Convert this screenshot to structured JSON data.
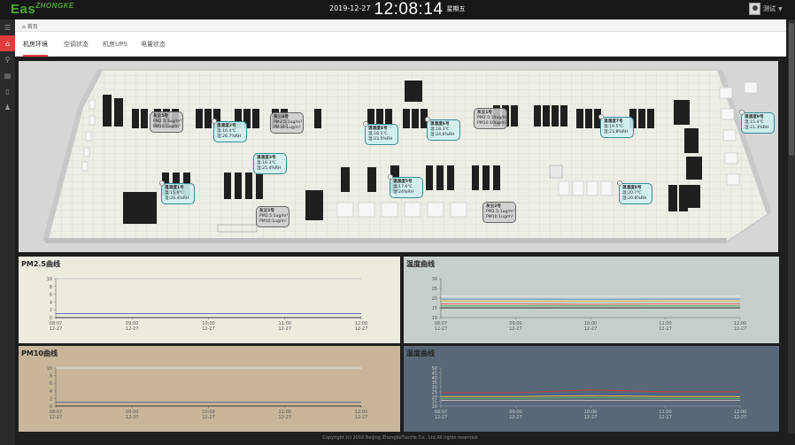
{
  "header": {
    "logo_main": "Eas",
    "logo_sup": "ZHONGKE",
    "date": "2019-12-27",
    "time": "12:08:14",
    "weekday": "星期五",
    "username": "测试"
  },
  "sidebar": {
    "icons": [
      "menu-icon",
      "home-icon",
      "search-icon",
      "list-icon",
      "bookmark-icon",
      "user-icon"
    ],
    "active": 1
  },
  "breadcrumb": {
    "label": "首页"
  },
  "tabs": [
    {
      "label": "机房环境",
      "active": true
    },
    {
      "label": "空调状态",
      "active": false
    },
    {
      "label": "机房UPS",
      "active": false
    },
    {
      "label": "电量状态",
      "active": false
    }
  ],
  "sensors": [
    {
      "kind": "dust",
      "title": "灰尘5号",
      "l1": "PM2.5:1ug/m³",
      "l2": "PM10:1ug/m³"
    },
    {
      "kind": "th",
      "title": "温湿度2号",
      "l1": "温:16.4℃",
      "l2": "湿:26.7%RH"
    },
    {
      "kind": "dust",
      "title": "灰尘4号",
      "l1": "PM2.5:1ug/m³",
      "l2": "PM10:1ug/m³"
    },
    {
      "kind": "th",
      "title": "温湿度4号",
      "l1": "温:18.2℃",
      "l2": "湿:23.5%RH"
    },
    {
      "kind": "th",
      "title": "温湿度6号",
      "l1": "温:18.3℃",
      "l2": "湿:24.6%RH"
    },
    {
      "kind": "dust",
      "title": "灰尘1号",
      "l1": "PM2.5:10ug/m³",
      "l2": "PM10:10ug/m³"
    },
    {
      "kind": "th",
      "title": "温湿度7号",
      "l1": "温:19.5℃",
      "l2": "湿:23.8%RH"
    },
    {
      "kind": "th",
      "title": "温湿度9号",
      "l1": "温:15.4℃",
      "l2": "湿:21.3%RH"
    },
    {
      "kind": "th",
      "title": "温湿度3号",
      "l1": "温:16.3℃",
      "l2": "湿:25.4%RH"
    },
    {
      "kind": "th",
      "title": "温湿度1号",
      "l1": "温:15.9℃",
      "l2": "湿:28.4%RH"
    },
    {
      "kind": "th",
      "title": "温湿度5号",
      "l1": "温:17.6℃",
      "l2": "湿:24%RH"
    },
    {
      "kind": "dust",
      "title": "灰尘1号",
      "l1": "PM2.5:1ug/m³",
      "l2": "PM10:1ug/m³"
    },
    {
      "kind": "dust",
      "title": "灰尘2号",
      "l1": "PM2.5:1ug/m³",
      "l2": "PM10:1ug/m³"
    },
    {
      "kind": "th",
      "title": "温湿度8号",
      "l1": "温:20.7℃",
      "l2": "湿:20.8%RH"
    }
  ],
  "chart_data": [
    {
      "type": "line",
      "title": "PM2.5曲线",
      "background": "#edeade",
      "x": [
        "08:07\n12-27",
        "09:00\n12-27",
        "10:00\n12-27",
        "11:00\n12-27",
        "12:00\n12-27"
      ],
      "yticks": [
        0,
        2,
        4,
        6,
        8,
        10
      ],
      "ylim": [
        0,
        10
      ],
      "series": [
        {
          "color": "#c8c8c8",
          "values": [
            10,
            10,
            10,
            10,
            10
          ]
        },
        {
          "color": "#e05050",
          "values": [
            1,
            1,
            1,
            1,
            1
          ]
        },
        {
          "color": "#4a6fb0",
          "values": [
            1,
            1,
            1,
            1,
            1
          ]
        },
        {
          "color": "#333333",
          "values": [
            0,
            0,
            0,
            0,
            0
          ]
        }
      ]
    },
    {
      "type": "line",
      "title": "温度曲线",
      "background": "#c6cfcb",
      "x": [
        "08:07\n12-27",
        "09:00\n12-27",
        "10:00\n12-27",
        "11:00\n12-27",
        "12:00\n12-27"
      ],
      "yticks": [
        10,
        15,
        20,
        25,
        30
      ],
      "ylim": [
        10,
        30
      ],
      "series": [
        {
          "color": "#f0f0f0",
          "values": [
            21,
            21,
            21,
            21,
            21
          ]
        },
        {
          "color": "#5a8ad0",
          "values": [
            19.5,
            19.5,
            19.4,
            19.5,
            19.5
          ]
        },
        {
          "color": "#e8c040",
          "values": [
            18.6,
            18.5,
            18.5,
            18.6,
            18.6
          ]
        },
        {
          "color": "#e06060",
          "values": [
            17,
            17,
            16.8,
            17,
            17
          ]
        },
        {
          "color": "#50a050",
          "values": [
            16,
            16,
            16,
            16,
            16
          ]
        },
        {
          "color": "#333333",
          "values": [
            15,
            15,
            15,
            15,
            15
          ]
        }
      ]
    },
    {
      "type": "line",
      "title": "PM10曲线",
      "background": "#c8b59a",
      "x": [
        "08:07\n12-27",
        "09:00\n12-27",
        "10:00\n12-27",
        "11:00\n12-27",
        "12:00\n12-27"
      ],
      "yticks": [
        0,
        2,
        4,
        6,
        8,
        10
      ],
      "ylim": [
        0,
        10
      ],
      "series": [
        {
          "color": "#e6e6e6",
          "values": [
            10,
            10,
            10,
            10,
            10
          ]
        },
        {
          "color": "#e05050",
          "values": [
            1,
            1,
            1,
            1,
            1
          ]
        },
        {
          "color": "#4a6fb0",
          "values": [
            1,
            1,
            1,
            1,
            1
          ]
        },
        {
          "color": "#333333",
          "values": [
            0,
            0,
            0,
            0,
            0
          ]
        }
      ]
    },
    {
      "type": "line",
      "title": "湿度曲线",
      "background": "#586878",
      "x": [
        "08:07\n12-27",
        "09:00\n12-27",
        "10:00\n12-27",
        "11:00\n12-27",
        "12:00\n12-27"
      ],
      "yticks": [
        10,
        15,
        20,
        25,
        30,
        35,
        40,
        45,
        50
      ],
      "ylim": [
        10,
        50
      ],
      "series": [
        {
          "color": "#d03a3a",
          "values": [
            24,
            24,
            27,
            25,
            25
          ]
        },
        {
          "color": "#3a5aa8",
          "values": [
            22,
            22,
            23,
            22,
            22
          ]
        },
        {
          "color": "#e8c040",
          "values": [
            20,
            20,
            21,
            20,
            20
          ]
        },
        {
          "color": "#60b060",
          "values": [
            18,
            18,
            19,
            18,
            18
          ]
        },
        {
          "color": "#cccccc",
          "values": [
            16,
            16,
            16,
            16,
            16
          ]
        }
      ]
    }
  ],
  "footer": {
    "copyright": "Copyright (c) 2018 Beijing ZhongKeTianHe Co., Ltd.All rights reserved."
  }
}
